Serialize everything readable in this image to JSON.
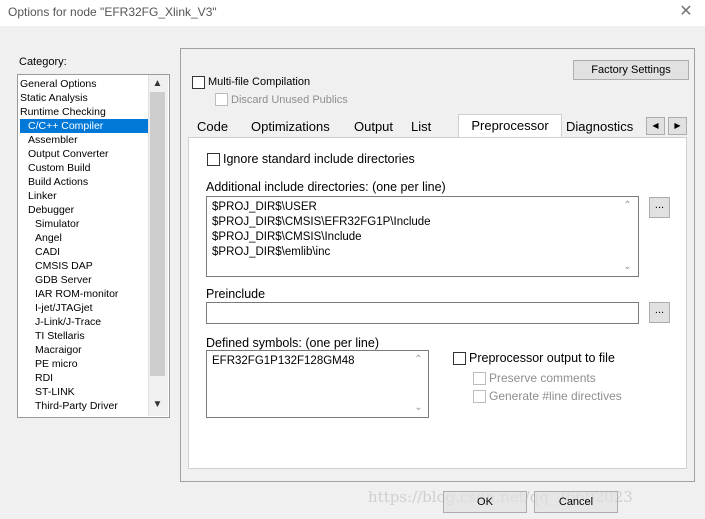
{
  "window": {
    "title": "Options for node \"EFR32FG_Xlink_V3\"",
    "close": "✕"
  },
  "category": {
    "label": "Category:",
    "items": [
      "General Options",
      "Static Analysis",
      "Runtime Checking",
      "C/C++ Compiler",
      "Assembler",
      "Output Converter",
      "Custom Build",
      "Build Actions",
      "Linker",
      "Debugger",
      "Simulator",
      "Angel",
      "CADI",
      "CMSIS DAP",
      "GDB Server",
      "IAR ROM-monitor",
      "I-jet/JTAGjet",
      "J-Link/J-Trace",
      "TI Stellaris",
      "Macraigor",
      "PE micro",
      "RDI",
      "ST-LINK",
      "Third-Party Driver"
    ],
    "selected_index": 3
  },
  "options": {
    "factory_settings": "Factory Settings",
    "multifile": "Multi-file Compilation",
    "discard": "Discard Unused Publics"
  },
  "tabs": [
    "Code",
    "Optimizations",
    "Output",
    "List",
    "Preprocessor",
    "Diagnostics"
  ],
  "active_tab": "Preprocessor",
  "preprocessor": {
    "ignore_std": "Ignore standard include directories",
    "include_label": "Additional include directories: (one per line)",
    "include_lines": [
      "$PROJ_DIR$\\USER",
      "$PROJ_DIR$\\CMSIS\\EFR32FG1P\\Include",
      "$PROJ_DIR$\\CMSIS\\Include",
      "$PROJ_DIR$\\emlib\\inc"
    ],
    "preinclude_label": "Preinclude",
    "preinclude_value": "",
    "defined_label": "Defined symbols: (one per line)",
    "defined_lines": [
      "EFR32FG1P132F128GM48"
    ],
    "pp_output": "Preprocessor output to file",
    "preserve": "Preserve comments",
    "generate_line": "Generate #line directives",
    "ellipsis": "..."
  },
  "buttons": {
    "ok": "OK",
    "cancel": "Cancel"
  },
  "watermark": "https://blog.csdn.net/qq_26602023"
}
